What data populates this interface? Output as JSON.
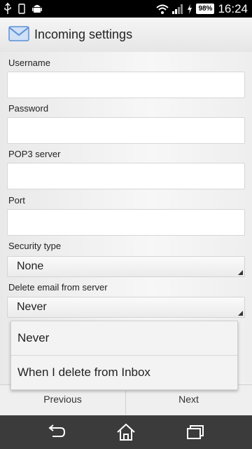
{
  "status_bar": {
    "battery": "98%",
    "time": "16:24"
  },
  "action_bar": {
    "title": "Incoming settings"
  },
  "form": {
    "username_label": "Username",
    "username_value": "",
    "password_label": "Password",
    "password_value": "",
    "pop3_label": "POP3 server",
    "pop3_value": "",
    "port_label": "Port",
    "port_value": "",
    "security_label": "Security type",
    "security_value": "None",
    "delete_label": "Delete email from server",
    "delete_value": "Never"
  },
  "dropdown": {
    "options": [
      "Never",
      "When I delete from Inbox"
    ]
  },
  "buttons": {
    "previous": "Previous",
    "next": "Next"
  },
  "colors": {
    "status_bar": "#000000",
    "nav_bar": "#3b3b3b",
    "accent_envelope": "#5b8fd6"
  }
}
